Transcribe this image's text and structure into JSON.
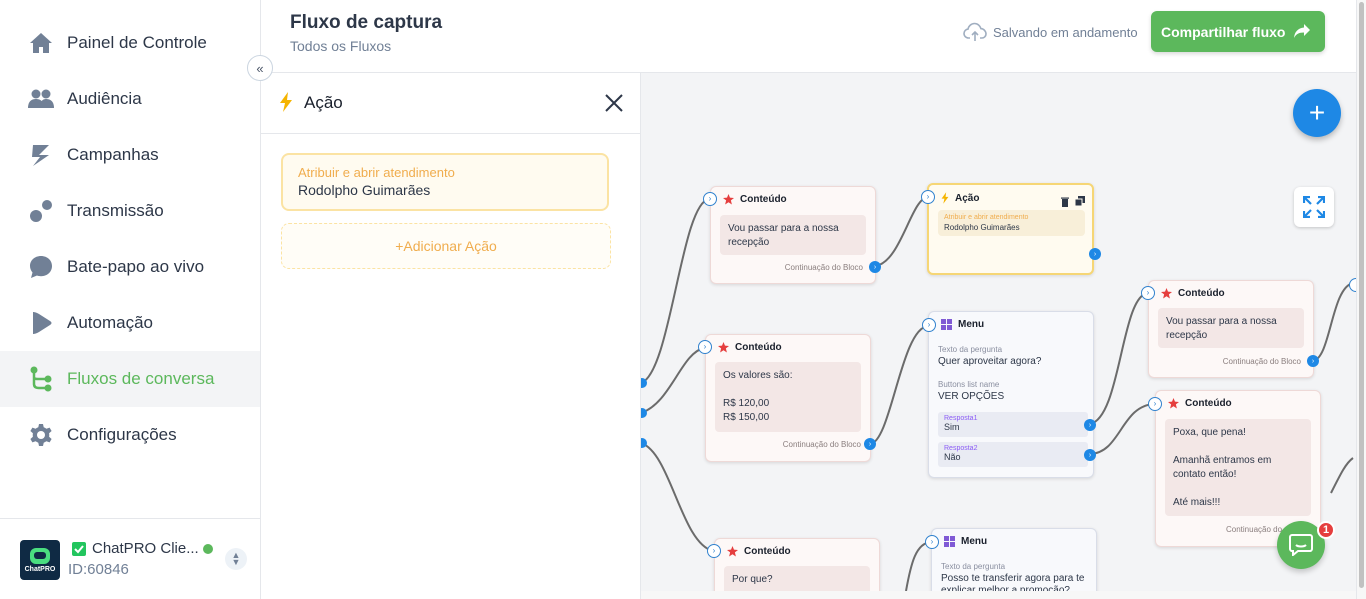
{
  "sidebar": {
    "items": [
      {
        "label": "Painel de Controle",
        "icon": "home-icon"
      },
      {
        "label": "Audiência",
        "icon": "users-icon"
      },
      {
        "label": "Campanhas",
        "icon": "campaign-icon"
      },
      {
        "label": "Transmissão",
        "icon": "broadcast-icon"
      },
      {
        "label": "Bate-papo ao vivo",
        "icon": "chat-icon"
      },
      {
        "label": "Automação",
        "icon": "automation-icon"
      },
      {
        "label": "Fluxos de conversa",
        "icon": "flow-icon"
      },
      {
        "label": "Configurações",
        "icon": "gear-icon"
      }
    ],
    "active_index": 6,
    "account": {
      "name": "ChatPRO Clie...",
      "id_label": "ID:60846",
      "logo_text": "ChatPRO"
    }
  },
  "header": {
    "title": "Fluxo de captura",
    "subtitle": "Todos os Fluxos",
    "saving_status": "Salvando em andamento",
    "share_button": "Compartilhar fluxo"
  },
  "panel": {
    "title": "Ação",
    "action": {
      "label": "Atribuir e abrir atendimento",
      "value": "Rodolpho Guimarães"
    },
    "add_action": "+Adicionar Ação"
  },
  "canvas": {
    "nodes": {
      "content_a": {
        "title": "Conteúdo",
        "text": "Vou passar para a nossa recepção",
        "footer": "Continuação do Bloco"
      },
      "action_a": {
        "title": "Ação",
        "label": "Atribuir e abrir atendimento",
        "value": "Rodolpho Guimarães"
      },
      "content_b": {
        "title": "Conteúdo",
        "text_lines": [
          "Os valores são:",
          "",
          "R$ 120,00",
          "R$ 150,00"
        ],
        "footer": "Continuação do Bloco"
      },
      "menu_a": {
        "title": "Menu",
        "question_label": "Texto da pergunta",
        "question": "Quer aproveitar agora?",
        "buttons_label": "Buttons list name",
        "buttons_value": "VER OPÇÕES",
        "responses": [
          {
            "label": "Resposta1",
            "value": "Sim"
          },
          {
            "label": "Resposta2",
            "value": "Não"
          }
        ]
      },
      "content_c": {
        "title": "Conteúdo",
        "text": "Vou passar para a nossa recepção",
        "footer": "Continuação do Bloco"
      },
      "content_d": {
        "title": "Conteúdo",
        "text_lines": [
          "Poxa, que pena!",
          "",
          "Amanhã entramos em contato então!",
          "",
          "Até mais!!!"
        ],
        "footer": "Continuação do"
      },
      "content_e": {
        "title": "Conteúdo",
        "text": "Por que?"
      },
      "menu_b": {
        "title": "Menu",
        "question_label": "Texto da pergunta",
        "question": "Posso te transferir agora para te explicar melhor a promoção?"
      }
    },
    "chat_badge": "1"
  },
  "colors": {
    "brand_green": "#5cb85c",
    "accent_blue": "#1e88e5",
    "action_yellow": "#f0ad4e"
  }
}
